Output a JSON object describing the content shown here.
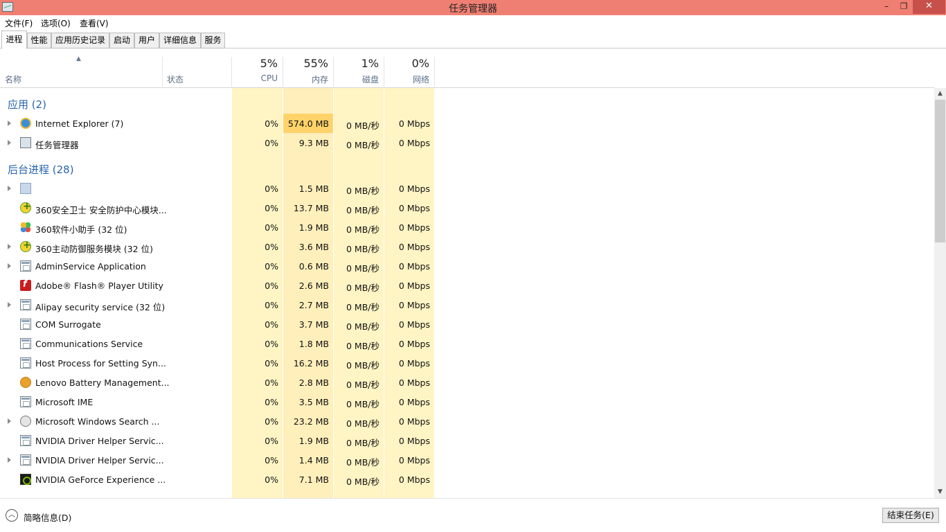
{
  "window": {
    "title": "任务管理器",
    "min": "–",
    "max": "❐",
    "close": "✕"
  },
  "menu": [
    "文件(F)",
    "选项(O)",
    "查看(V)"
  ],
  "tabs": [
    "进程",
    "性能",
    "应用历史记录",
    "启动",
    "用户",
    "详细信息",
    "服务"
  ],
  "columns": {
    "name": "名称",
    "status": "状态",
    "cpu": {
      "pct": "5%",
      "label": "CPU"
    },
    "mem": {
      "pct": "55%",
      "label": "内存"
    },
    "disk": {
      "pct": "1%",
      "label": "磁盘"
    },
    "net": {
      "pct": "0%",
      "label": "网络"
    }
  },
  "groups": {
    "apps": "应用 (2)",
    "background": "后台进程 (28)"
  },
  "apps": [
    {
      "name": "Internet Explorer (7)",
      "cpu": "0%",
      "mem": "574.0 MB",
      "disk": "0 MB/秒",
      "net": "0 Mbps",
      "icon": "ie-icon"
    },
    {
      "name": "任务管理器",
      "cpu": "0%",
      "mem": "9.3 MB",
      "disk": "0 MB/秒",
      "net": "0 Mbps",
      "icon": "task-manager-icon"
    }
  ],
  "background": [
    {
      "name": "",
      "cpu": "0%",
      "mem": "1.5 MB",
      "disk": "0 MB/秒",
      "net": "0 Mbps",
      "icon": "gear-icon"
    },
    {
      "name": "360安全卫士 安全防护中心模块...",
      "cpu": "0%",
      "mem": "13.7 MB",
      "disk": "0 MB/秒",
      "net": "0 Mbps",
      "icon": "360-icon"
    },
    {
      "name": "360软件小助手 (32 位)",
      "cpu": "0%",
      "mem": "1.9 MB",
      "disk": "0 MB/秒",
      "net": "0 Mbps",
      "icon": "360-soft-icon"
    },
    {
      "name": "360主动防御服务模块 (32 位)",
      "cpu": "0%",
      "mem": "3.6 MB",
      "disk": "0 MB/秒",
      "net": "0 Mbps",
      "icon": "360-icon"
    },
    {
      "name": "AdminService Application",
      "cpu": "0%",
      "mem": "0.6 MB",
      "disk": "0 MB/秒",
      "net": "0 Mbps",
      "icon": "window-icon"
    },
    {
      "name": "Adobe® Flash® Player Utility",
      "cpu": "0%",
      "mem": "2.6 MB",
      "disk": "0 MB/秒",
      "net": "0 Mbps",
      "icon": "flash-icon"
    },
    {
      "name": "Alipay security service (32 位)",
      "cpu": "0%",
      "mem": "2.7 MB",
      "disk": "0 MB/秒",
      "net": "0 Mbps",
      "icon": "window-icon"
    },
    {
      "name": "COM Surrogate",
      "cpu": "0%",
      "mem": "3.7 MB",
      "disk": "0 MB/秒",
      "net": "0 Mbps",
      "icon": "window-icon"
    },
    {
      "name": "Communications Service",
      "cpu": "0%",
      "mem": "1.8 MB",
      "disk": "0 MB/秒",
      "net": "0 Mbps",
      "icon": "window-icon"
    },
    {
      "name": "Host Process for Setting Syn...",
      "cpu": "0%",
      "mem": "16.2 MB",
      "disk": "0 MB/秒",
      "net": "0 Mbps",
      "icon": "window-icon"
    },
    {
      "name": "Lenovo Battery Management...",
      "cpu": "0%",
      "mem": "2.8 MB",
      "disk": "0 MB/秒",
      "net": "0 Mbps",
      "icon": "lenovo-icon"
    },
    {
      "name": "Microsoft IME",
      "cpu": "0%",
      "mem": "3.5 MB",
      "disk": "0 MB/秒",
      "net": "0 Mbps",
      "icon": "window-icon"
    },
    {
      "name": "Microsoft Windows Search ...",
      "cpu": "0%",
      "mem": "23.2 MB",
      "disk": "0 MB/秒",
      "net": "0 Mbps",
      "icon": "search-icon"
    },
    {
      "name": "NVIDIA Driver Helper Servic...",
      "cpu": "0%",
      "mem": "1.9 MB",
      "disk": "0 MB/秒",
      "net": "0 Mbps",
      "icon": "window-icon"
    },
    {
      "name": "NVIDIA Driver Helper Servic...",
      "cpu": "0%",
      "mem": "1.4 MB",
      "disk": "0 MB/秒",
      "net": "0 Mbps",
      "icon": "window-icon"
    },
    {
      "name": "NVIDIA GeForce Experience ...",
      "cpu": "0%",
      "mem": "7.1 MB",
      "disk": "0 MB/秒",
      "net": "0 Mbps",
      "icon": "nvidia-icon"
    }
  ],
  "footer": {
    "brief": "简略信息(D)",
    "end_task": "结束任务(E)"
  },
  "colors": {
    "titlebar": "#f07f73",
    "cpu_col": "#fff4c4",
    "mem_col": "#ffe9a8",
    "mem_high": "#ffd36a",
    "group_text": "#2764b0"
  }
}
